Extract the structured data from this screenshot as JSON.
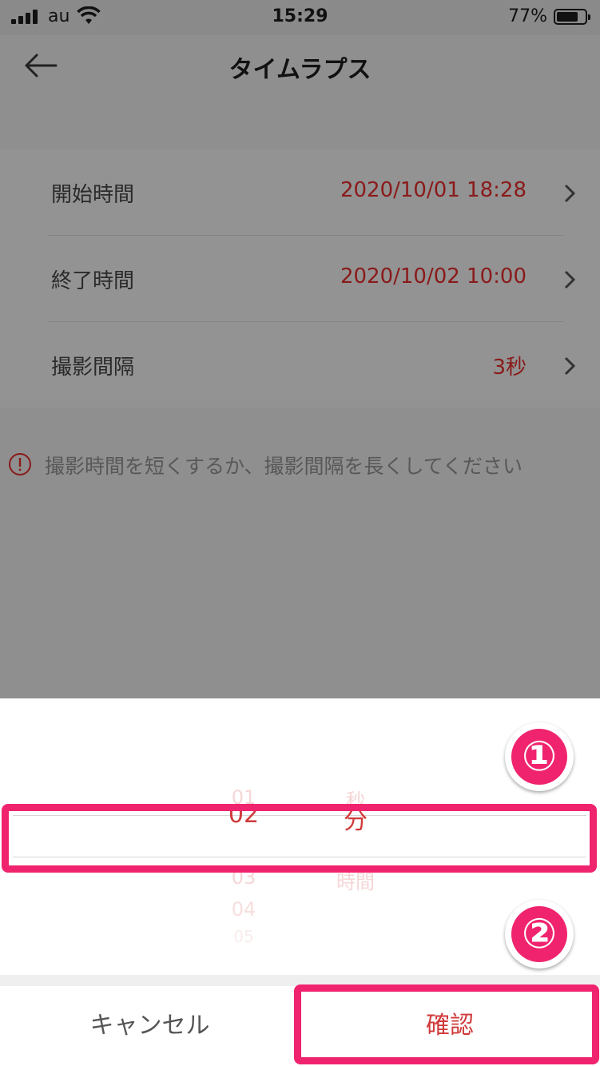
{
  "status_bar": {
    "carrier": "au",
    "time": "15:29",
    "battery_pct": "77%",
    "battery_level": 0.77
  },
  "nav": {
    "title": "タイムラプス",
    "back_icon": "arrow-left-icon"
  },
  "settings": [
    {
      "label": "開始時間",
      "value": "2020/10/01 18:28"
    },
    {
      "label": "終了時間",
      "value": "2020/10/02 10:00"
    },
    {
      "label": "撮影間隔",
      "value": "3秒"
    }
  ],
  "warning": {
    "icon": "alert-circle-icon",
    "text": "撮影時間を短くするか、撮影間隔を長くしてください"
  },
  "picker": {
    "numbers": [
      "01",
      "02",
      "03",
      "04",
      "05"
    ],
    "selected_number": "02",
    "units": [
      "秒",
      "分",
      "時間"
    ],
    "selected_unit": "分"
  },
  "annotations": {
    "step1": "①",
    "step2": "②",
    "color": "#f0246e"
  },
  "actions": {
    "cancel": "キャンセル",
    "confirm": "確認"
  },
  "colors": {
    "accent": "#d03a3a",
    "value_dim": "#8a1a1a",
    "overlay": "#8f8f8f"
  }
}
